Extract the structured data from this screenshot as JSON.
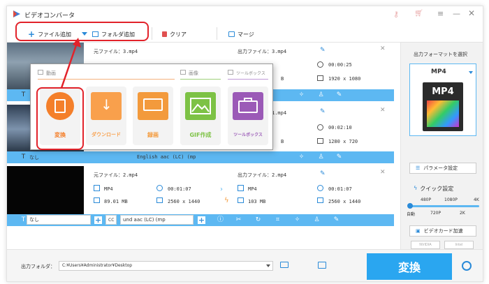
{
  "app": {
    "title": "ビデオコンバータ"
  },
  "toolbar": {
    "add_file": "ファイル追加",
    "add_folder": "フォルダ追加",
    "clear": "クリア",
    "merge": "マージ"
  },
  "popup": {
    "section_video": "動画",
    "section_image": "画像",
    "section_toolbox": "ツールボックス",
    "tiles": [
      {
        "label": "変換",
        "color": "#f47f2a"
      },
      {
        "label": "ダウンロード",
        "color": "#f9a04c"
      },
      {
        "label": "録画",
        "color": "#f39a3c"
      },
      {
        "label": "GIF作成",
        "color": "#7dc245"
      },
      {
        "label": "ツールボックス",
        "color": "#9b5ab7"
      }
    ]
  },
  "rows": [
    {
      "src_file": "元ファイル：3.mp4",
      "out_file": "出力ファイル：3.mp4",
      "out_duration": "00:00:25",
      "out_resolution": "1920 x 1080",
      "out_size": "B",
      "subtitle": "",
      "audio": ""
    },
    {
      "src_file": "",
      "out_file": "出力ファイル：1.mp4",
      "out_duration": "00:02:10",
      "out_resolution": "1280 x 720",
      "out_size": "B",
      "subtitle": "なし",
      "audio": "English aac (LC) (mp"
    },
    {
      "src_file": "元ファイル：2.mp4",
      "src_format": "MP4",
      "src_duration": "00:01:07",
      "src_size": "89.01 MB",
      "src_resolution": "2560 x 1440",
      "out_file": "出力ファイル：2.mp4",
      "out_format": "MP4",
      "out_duration": "00:01:07",
      "out_size": "103 MB",
      "out_resolution": "2560 x 1440",
      "subtitle": "なし",
      "audio": "und aac (LC) (mp"
    }
  ],
  "rightpanel": {
    "format_title": "出力フォーマットを選択",
    "format_value": "MP4",
    "format_badge": "MP4",
    "param_button": "パラメータ設定",
    "quick_title": "クイック設定",
    "quality_top": [
      "480P",
      "1080P",
      "4K"
    ],
    "quality_bottom": [
      "自動",
      "720P",
      "2K"
    ],
    "accel_button": "ビデオカード加速",
    "gpu_labels": [
      "NVIDIA",
      "Intel"
    ]
  },
  "bottom": {
    "output_label": "出力フォルダ：",
    "output_path": "C:¥Users¥Administrator¥Desktop",
    "convert_button": "変換"
  },
  "colors": {
    "accent": "#5db8f2",
    "highlight": "#e2222a",
    "convert": "#2aa6f0"
  }
}
